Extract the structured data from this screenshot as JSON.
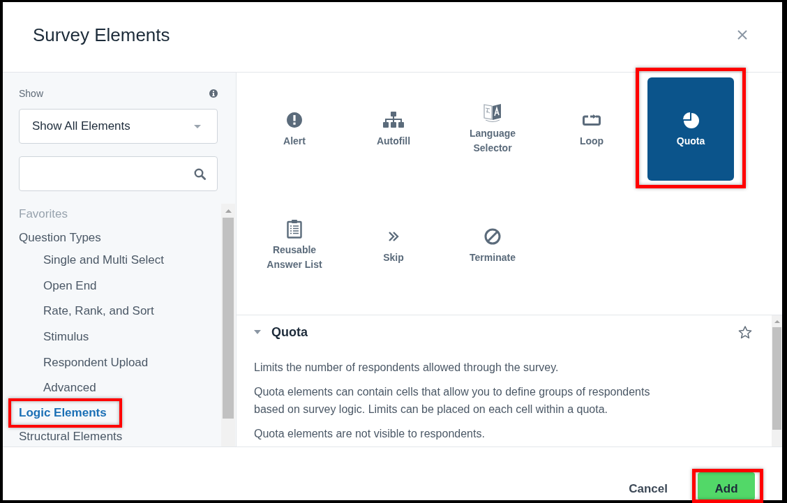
{
  "dialog": {
    "title": "Survey Elements"
  },
  "sidebar": {
    "filter": {
      "label": "Show",
      "value": "Show All Elements"
    },
    "tree": [
      {
        "label": "Favorites",
        "selected": false,
        "disabled": true,
        "highlighted": false
      },
      {
        "label": "Question Types",
        "selected": false,
        "disabled": false,
        "highlighted": false,
        "children": [
          {
            "label": "Single and Multi Select",
            "selected": false
          },
          {
            "label": "Open End",
            "selected": false
          },
          {
            "label": "Rate, Rank, and Sort",
            "selected": false
          },
          {
            "label": "Stimulus",
            "selected": false
          },
          {
            "label": "Respondent Upload",
            "selected": false
          },
          {
            "label": "Advanced",
            "selected": false
          }
        ]
      },
      {
        "label": "Logic Elements",
        "selected": true,
        "disabled": false,
        "highlighted": true
      },
      {
        "label": "Structural Elements",
        "selected": false,
        "disabled": false,
        "highlighted": false
      }
    ]
  },
  "tiles": [
    {
      "kind": "alert",
      "label": "Alert",
      "selected": false,
      "highlighted": false
    },
    {
      "kind": "autofill",
      "label": "Autofill",
      "selected": false,
      "highlighted": false
    },
    {
      "kind": "language",
      "label": "Language Selector",
      "selected": false,
      "highlighted": false
    },
    {
      "kind": "loop",
      "label": "Loop",
      "selected": false,
      "highlighted": false
    },
    {
      "kind": "quota",
      "label": "Quota",
      "selected": true,
      "highlighted": true
    },
    {
      "kind": "list",
      "label": "Reusable Answer List",
      "selected": false,
      "highlighted": false
    },
    {
      "kind": "skip",
      "label": "Skip",
      "selected": false,
      "highlighted": false
    },
    {
      "kind": "terminate",
      "label": "Terminate",
      "selected": false,
      "highlighted": false
    }
  ],
  "details": {
    "title": "Quota",
    "expanded": true,
    "starred": false,
    "paragraphs": [
      "Limits the number of respondents allowed through the survey.",
      "Quota elements can contain cells that allow you to define groups of respondents based on survey logic. Limits can be placed on each cell within a quota.",
      "Quota elements are not visible to respondents."
    ]
  },
  "footer": {
    "buttons": [
      {
        "kind": "secondary",
        "label": "Cancel",
        "highlighted": false
      },
      {
        "kind": "primary",
        "label": "Add",
        "highlighted": true
      }
    ]
  }
}
